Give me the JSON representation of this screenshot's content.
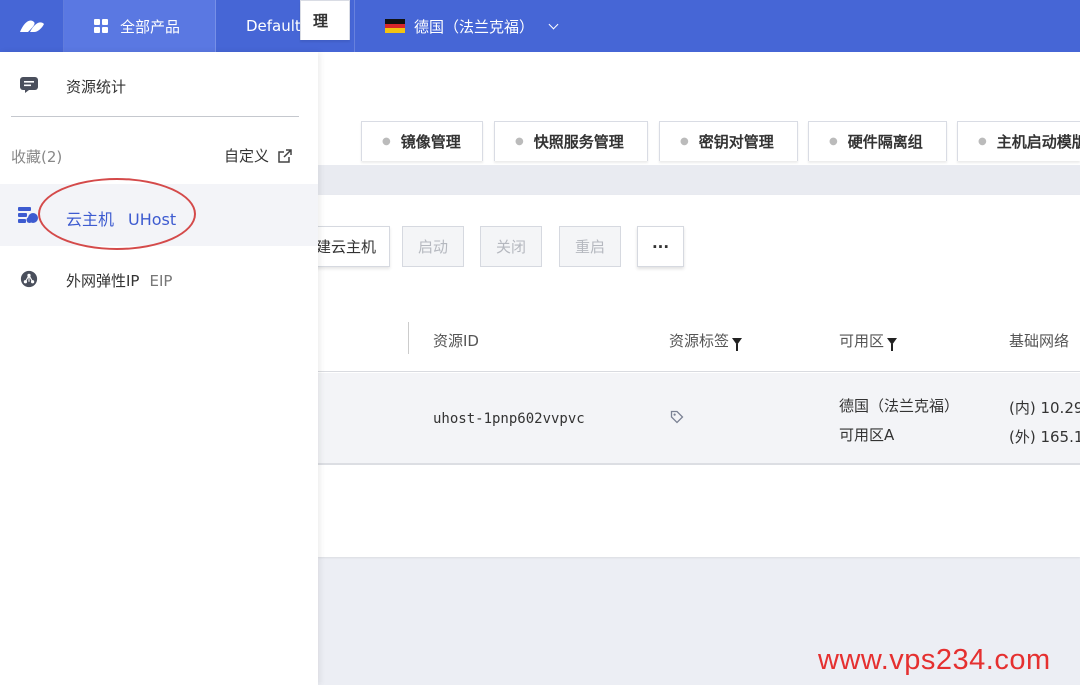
{
  "topbar": {
    "products_label": "全部产品",
    "project_label": "Default",
    "region_label": "德国（法兰克福）"
  },
  "tabs": [
    {
      "label": "理"
    },
    {
      "label": "镜像管理"
    },
    {
      "label": "快照服务管理"
    },
    {
      "label": "密钥对管理"
    },
    {
      "label": "硬件隔离组"
    },
    {
      "label": "主机启动模版"
    }
  ],
  "toolbar": {
    "create_label": "建云主机",
    "start_label": "启动",
    "stop_label": "关闭",
    "restart_label": "重启",
    "more_label": "···"
  },
  "table": {
    "headers": {
      "resource_id": "资源ID",
      "resource_tag": "资源标签",
      "zone": "可用区",
      "network": "基础网络"
    },
    "row": {
      "resource_id": "uhost-1pnp602vvpvc",
      "zone_line1": "德国（法兰克福）",
      "zone_line2": "可用区A",
      "ip_inner": "(内) 10.29",
      "ip_outer": "(外) 165.1"
    }
  },
  "sidebar": {
    "stats_label": "资源统计",
    "favorites_label": "收藏(2)",
    "customize_label": "自定义",
    "items": [
      {
        "label": "云主机",
        "en": "UHost"
      },
      {
        "label": "外网弹性IP",
        "en": "EIP"
      }
    ]
  },
  "watermark": "www.vps234.com",
  "colors": {
    "topbar": "#4666d6",
    "accent": "#3d5bd0",
    "annotation": "#d44a4a",
    "watermark": "#e53030"
  }
}
